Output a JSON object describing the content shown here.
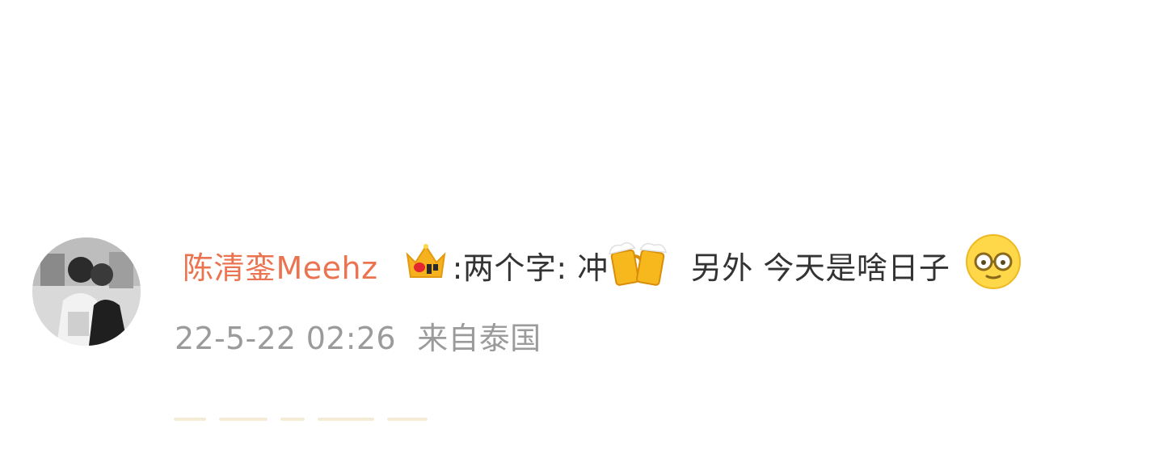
{
  "comment": {
    "username": "陈清銮Meehz",
    "segments": {
      "part1": ":两个字: 冲",
      "part2": "另外 今天是啥日子"
    },
    "icons": {
      "badge": "crown-badge-icon",
      "beer": "beer-mugs-emoji",
      "face": "nerd-face-emoji"
    },
    "timestamp": "22-5-22 02:26",
    "location": "来自泰国"
  },
  "colors": {
    "username": "#eb7350",
    "text": "#333333",
    "meta": "#9b9b9b",
    "badge": "#f5b21e",
    "beer": "#f6b81d"
  }
}
